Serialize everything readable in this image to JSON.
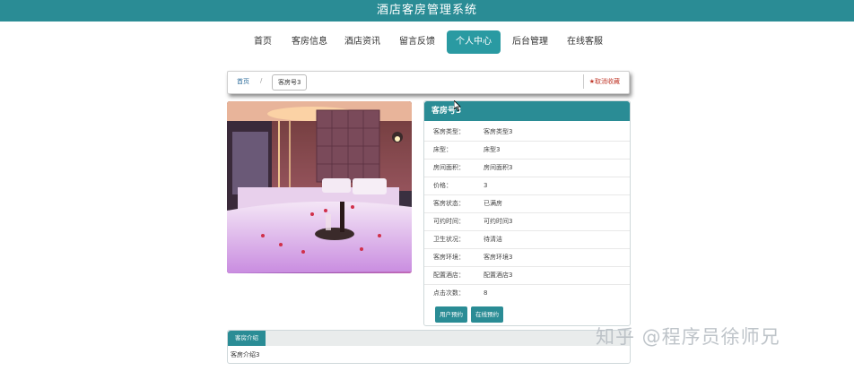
{
  "header": {
    "title": "酒店客房管理系统"
  },
  "nav": {
    "items": [
      {
        "label": "首页"
      },
      {
        "label": "客房信息"
      },
      {
        "label": "酒店资讯"
      },
      {
        "label": "留言反馈"
      },
      {
        "label": "个人中心",
        "active": true
      },
      {
        "label": "后台管理"
      },
      {
        "label": "在线客服"
      }
    ]
  },
  "breadcrumb": {
    "home": "首页",
    "separator": "/",
    "current": "客房号3",
    "favorite": "★取消收藏"
  },
  "detail": {
    "title": "客房号3",
    "fields": [
      {
        "key": "客房类型：",
        "value": "客房类型3"
      },
      {
        "key": "床型：",
        "value": "床型3"
      },
      {
        "key": "房间面积：",
        "value": "房间面积3"
      },
      {
        "key": "价格：",
        "value": "3"
      },
      {
        "key": "客房状态：",
        "value": "已满房"
      },
      {
        "key": "可约时间：",
        "value": "可约时间3"
      },
      {
        "key": "卫生状况：",
        "value": "待清洁"
      },
      {
        "key": "客房环境：",
        "value": "客房环境3"
      },
      {
        "key": "配置酒店：",
        "value": "配置酒店3"
      },
      {
        "key": "点击次数：",
        "value": "8"
      }
    ],
    "buttons": {
      "book": "用户预约",
      "online_book": "在线预约"
    }
  },
  "intro": {
    "tab": "客房介绍",
    "text": "客房介绍3"
  },
  "watermark": "知乎 @程序员徐师兄",
  "colors": {
    "accent": "#2a8c95",
    "favorite": "#c0392b"
  }
}
